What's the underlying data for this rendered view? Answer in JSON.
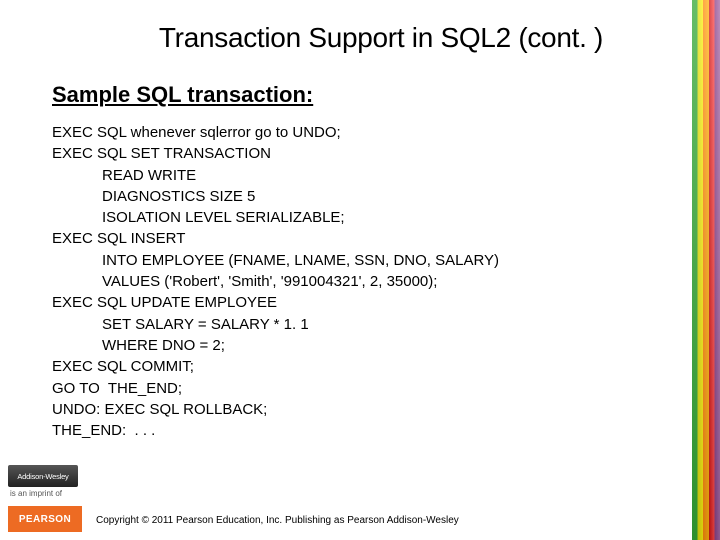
{
  "slide": {
    "title": "Transaction Support in SQL2 (cont. )",
    "subtitle": "Sample SQL transaction:",
    "code": "EXEC SQL whenever sqlerror go to UNDO;\nEXEC SQL SET TRANSACTION\n            READ WRITE\n            DIAGNOSTICS SIZE 5\n            ISOLATION LEVEL SERIALIZABLE;\nEXEC SQL INSERT\n            INTO EMPLOYEE (FNAME, LNAME, SSN, DNO, SALARY)\n            VALUES ('Robert', 'Smith', '991004321', 2, 35000);\nEXEC SQL UPDATE EMPLOYEE\n            SET SALARY = SALARY * 1. 1\n            WHERE DNO = 2;\nEXEC SQL COMMIT;\nGO TO  THE_END;\nUNDO: EXEC SQL ROLLBACK;\nTHE_END:  . . ."
  },
  "branding": {
    "publisher_logo": "Addison-Wesley",
    "imprint_text": "is an imprint of",
    "pearson_label": "PEARSON"
  },
  "footer": {
    "copyright": "Copyright © 2011 Pearson Education, Inc. Publishing as Pearson Addison-Wesley"
  }
}
